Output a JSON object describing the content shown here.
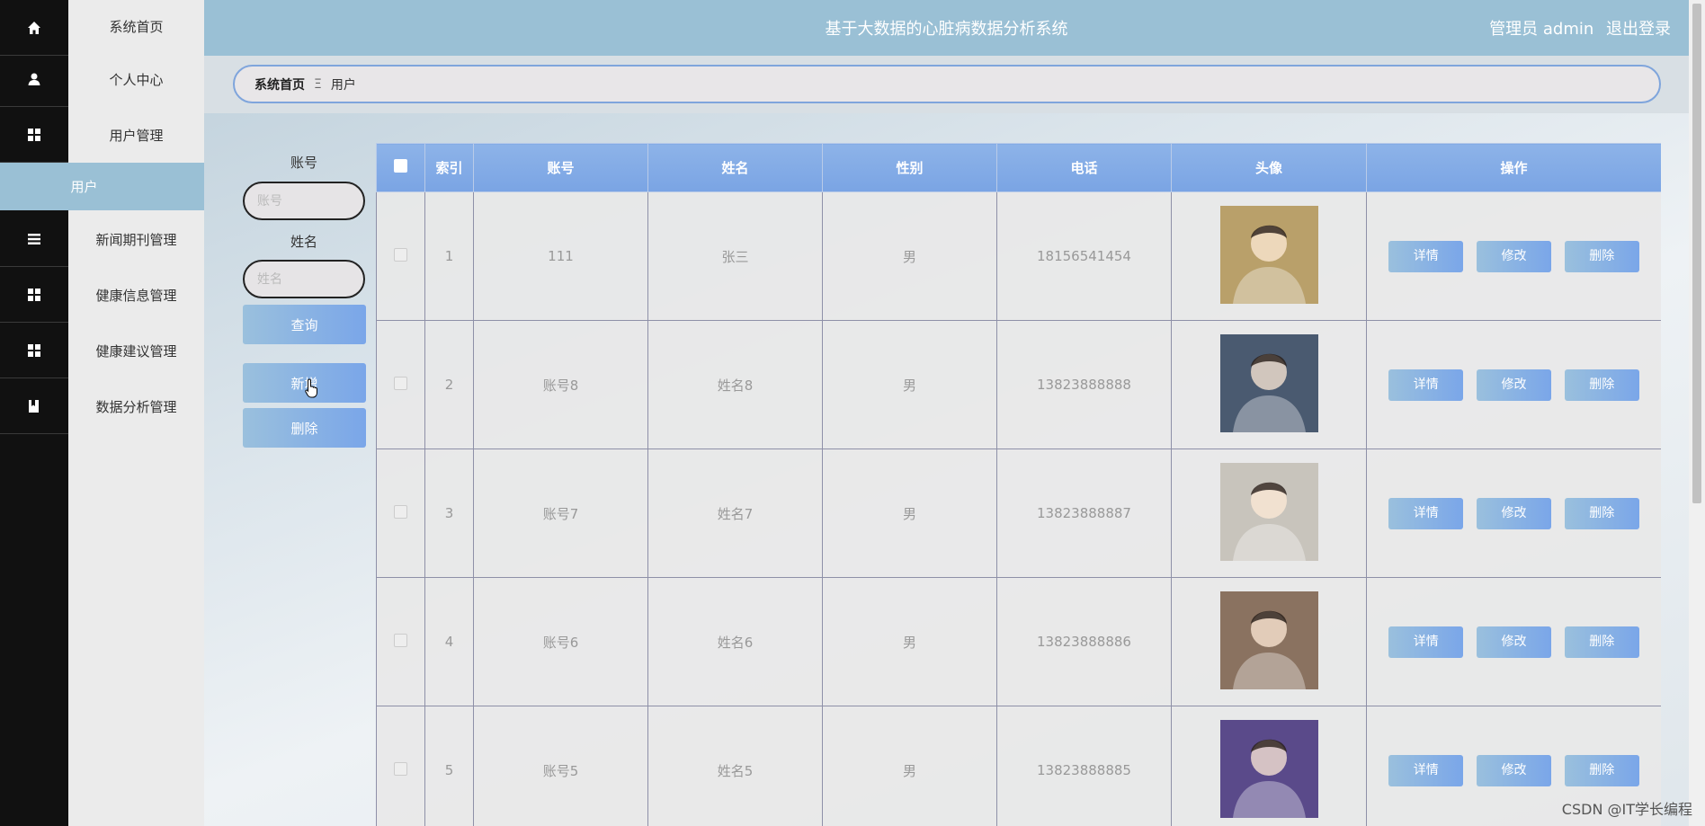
{
  "header": {
    "title": "基于大数据的心脏病数据分析系统",
    "user": "管理员 admin",
    "logout": "退出登录"
  },
  "sidebar": {
    "items": [
      {
        "label": "系统首页",
        "icon": "home-icon"
      },
      {
        "label": "个人中心",
        "icon": "person-icon"
      },
      {
        "label": "用户管理",
        "icon": "grid-icon"
      },
      {
        "label": "新闻期刊管理",
        "icon": "list-icon"
      },
      {
        "label": "健康信息管理",
        "icon": "grid-icon"
      },
      {
        "label": "健康建议管理",
        "icon": "grid-icon"
      },
      {
        "label": "数据分析管理",
        "icon": "book-icon"
      }
    ],
    "active_sub": "用户"
  },
  "breadcrumb": {
    "home": "系统首页",
    "sep": "Ξ",
    "current": "用户"
  },
  "search": {
    "account_label": "账号",
    "account_placeholder": "账号",
    "name_label": "姓名",
    "name_placeholder": "姓名",
    "query_button": "查询",
    "add_button": "新增",
    "delete_button": "删除"
  },
  "table": {
    "headers": [
      "索引",
      "账号",
      "姓名",
      "性别",
      "电话",
      "头像",
      "操作"
    ],
    "rows": [
      {
        "index": "1",
        "account": "111",
        "name": "张三",
        "gender": "男",
        "phone": "18156541454",
        "avatar_color": "#b9a06a"
      },
      {
        "index": "2",
        "account": "账号8",
        "name": "姓名8",
        "gender": "男",
        "phone": "13823888888",
        "avatar_color": "#4a5a70"
      },
      {
        "index": "3",
        "account": "账号7",
        "name": "姓名7",
        "gender": "男",
        "phone": "13823888887",
        "avatar_color": "#c8c4bc"
      },
      {
        "index": "4",
        "account": "账号6",
        "name": "姓名6",
        "gender": "男",
        "phone": "13823888886",
        "avatar_color": "#8a7260"
      },
      {
        "index": "5",
        "account": "账号5",
        "name": "姓名5",
        "gender": "男",
        "phone": "13823888885",
        "avatar_color": "#5a4a8a"
      }
    ],
    "actions": {
      "detail": "详情",
      "edit": "修改",
      "delete": "删除"
    }
  },
  "watermark": "CSDN @IT学长编程"
}
